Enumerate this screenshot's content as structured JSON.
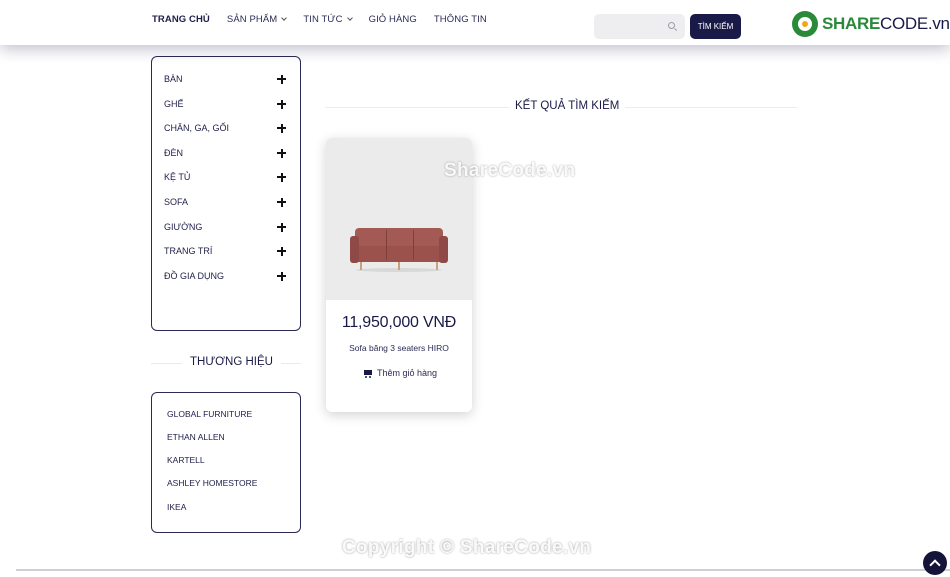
{
  "header": {
    "nav": [
      {
        "label": "TRANG CHỦ",
        "active": true,
        "dropdown": false
      },
      {
        "label": "SẢN PHẨM",
        "active": false,
        "dropdown": true
      },
      {
        "label": "TIN TỨC",
        "active": false,
        "dropdown": true
      },
      {
        "label": "GIỎ HÀNG",
        "active": false,
        "dropdown": false
      },
      {
        "label": "THÔNG TIN",
        "active": false,
        "dropdown": false
      }
    ],
    "search": {
      "placeholder": "",
      "value": "",
      "button_label": "TÌM KIẾM",
      "icon": "search-icon"
    },
    "logo": {
      "part1": "SHARE",
      "part2": "CODE.vn"
    }
  },
  "sidebar": {
    "categories": [
      {
        "label": "BÀN"
      },
      {
        "label": "GHẾ"
      },
      {
        "label": "CHĂN, GA, GỐI"
      },
      {
        "label": "ĐÈN"
      },
      {
        "label": "KỆ TỦ"
      },
      {
        "label": "SOFA"
      },
      {
        "label": "GIƯỜNG"
      },
      {
        "label": "TRANG TRÍ"
      },
      {
        "label": "ĐỒ GIA DỤNG"
      }
    ],
    "brands_title": "THƯƠNG HIỆU",
    "brands": [
      {
        "label": "GLOBAL FURNITURE"
      },
      {
        "label": "ETHAN ALLEN"
      },
      {
        "label": "KARTELL"
      },
      {
        "label": "ASHLEY HOMESTORE"
      },
      {
        "label": "IKEA"
      }
    ]
  },
  "main": {
    "results_title": "KẾT QUẢ TÌM KIẾM",
    "products": [
      {
        "price": "11,950,000 VNĐ",
        "name": "Sofa băng 3 seaters HIRO",
        "add_to_cart": "Thêm giỏ hàng"
      }
    ]
  },
  "watermarks": {
    "center": "ShareCode.vn",
    "footer": "Copyright © ShareCode.vn"
  },
  "colors": {
    "primary": "#1a1a48",
    "logo_green": "#2a8a3a",
    "border": "#2a2a55"
  }
}
